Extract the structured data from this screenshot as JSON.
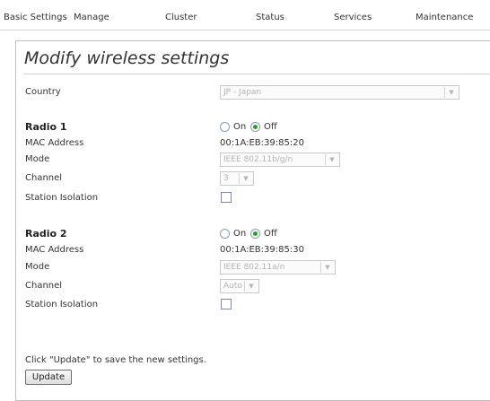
{
  "nav": {
    "tabs": [
      "Basic Settings",
      "Manage",
      "Cluster",
      "Status",
      "Services",
      "Maintenance"
    ]
  },
  "page": {
    "title": "Modify wireless settings"
  },
  "country": {
    "label": "Country",
    "value": "JP - Japan"
  },
  "radio1": {
    "heading": "Radio 1",
    "on_label": "On",
    "off_label": "Off",
    "selected": "Off",
    "mac_label": "MAC Address",
    "mac_value": "00:1A:EB:39:85:20",
    "mode_label": "Mode",
    "mode_value": "IEEE 802.11b/g/n",
    "channel_label": "Channel",
    "channel_value": "3",
    "isolation_label": "Station Isolation",
    "isolation_checked": false
  },
  "radio2": {
    "heading": "Radio 2",
    "on_label": "On",
    "off_label": "Off",
    "selected": "Off",
    "mac_label": "MAC Address",
    "mac_value": "00:1A:EB:39:85:30",
    "mode_label": "Mode",
    "mode_value": "IEEE 802.11a/n",
    "channel_label": "Channel",
    "channel_value": "Auto",
    "isolation_label": "Station Isolation",
    "isolation_checked": false
  },
  "footer": {
    "hint": "Click \"Update\" to save the new settings.",
    "update_label": "Update"
  },
  "icons": {
    "dropdown": "chevron-down-icon",
    "radio_selected": "radio-selected-icon"
  },
  "colors": {
    "radio_selected": "#2c9b2c",
    "disabled_text": "#b3b3b3"
  }
}
